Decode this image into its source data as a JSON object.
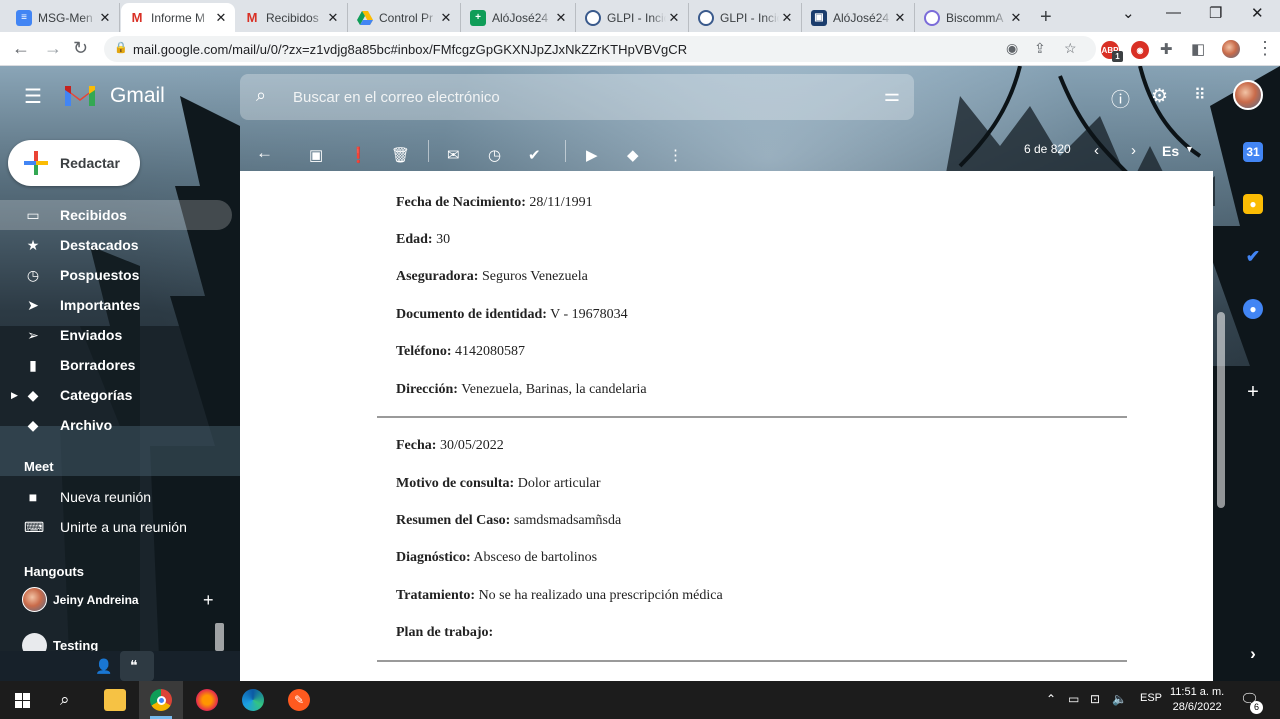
{
  "browser": {
    "tabs": [
      {
        "title": "MSG-Men",
        "icon": "docs-icon",
        "active": false
      },
      {
        "title": "Informe M",
        "icon": "gmail-icon",
        "active": true
      },
      {
        "title": "Recibidos",
        "icon": "gmail-icon",
        "active": false
      },
      {
        "title": "Control Pr",
        "icon": "drive-icon",
        "active": false
      },
      {
        "title": "AlóJosé24",
        "icon": "sheets-icon",
        "active": false
      },
      {
        "title": "GLPI - Incid",
        "icon": "glpi-icon",
        "active": false
      },
      {
        "title": "GLPI - Incid",
        "icon": "glpi-icon",
        "active": false
      },
      {
        "title": "AlóJosé24",
        "icon": "site-icon",
        "active": false
      },
      {
        "title": "BiscommA",
        "icon": "biscomm-icon",
        "active": false
      }
    ],
    "close_symbol": "✕",
    "new_tab_symbol": "+",
    "url": "mail.google.com/mail/u/0/?zx=z1vdjg8a85bc#inbox/FMfcgzGpGKXNJpZJxNkZZrKTHpVBVgCR",
    "extension_badge": "1"
  },
  "gmail": {
    "brand": "Gmail",
    "search_placeholder": "Buscar en el correo electrónico",
    "compose_label": "Redactar",
    "nav": [
      {
        "label": "Recibidos",
        "icon": "inbox-icon",
        "active": true
      },
      {
        "label": "Destacados",
        "icon": "star-icon",
        "active": false
      },
      {
        "label": "Pospuestos",
        "icon": "clock-icon",
        "active": false
      },
      {
        "label": "Importantes",
        "icon": "important-icon",
        "active": false
      },
      {
        "label": "Enviados",
        "icon": "send-icon",
        "active": false
      },
      {
        "label": "Borradores",
        "icon": "draft-icon",
        "active": false
      },
      {
        "label": "Categorías",
        "icon": "label-icon",
        "active": false
      },
      {
        "label": "Archivo",
        "icon": "label-icon",
        "active": false
      }
    ],
    "meet": {
      "title": "Meet",
      "items": [
        {
          "label": "Nueva reunión",
          "icon": "video-icon"
        },
        {
          "label": "Unirte a una reunión",
          "icon": "keyboard-icon"
        }
      ]
    },
    "hangouts": {
      "title": "Hangouts",
      "contacts": [
        "Jeiny Andreina",
        "Testing"
      ]
    },
    "pager": "6 de 820",
    "language": "Es"
  },
  "message": {
    "fields": [
      {
        "label": "Fecha de Nacimiento:",
        "value": "28/11/1991"
      },
      {
        "label": "Edad:",
        "value": "30"
      },
      {
        "label": "Aseguradora:",
        "value": "Seguros Venezuela"
      },
      {
        "label": "Documento de identidad:",
        "value": "V - 19678034"
      },
      {
        "label": "Teléfono:",
        "value": "4142080587"
      },
      {
        "label": "Dirección:",
        "value": "Venezuela, Barinas, la candelaria"
      }
    ],
    "consult_fields": [
      {
        "label": "Fecha:",
        "value": "30/05/2022"
      },
      {
        "label": "Motivo de consulta:",
        "value": "Dolor articular"
      },
      {
        "label": "Resumen del Caso:",
        "value": "samdsmadsamñsda"
      },
      {
        "label": "Diagnóstico:",
        "value": "Absceso de bartolinos"
      },
      {
        "label": "Tratamiento:",
        "value": "No se ha realizado una prescripción médica"
      },
      {
        "label": "Plan de trabajo:",
        "value": ""
      }
    ]
  },
  "taskbar": {
    "language": "ESP",
    "time": "11:51 a. m.",
    "date": "28/6/2022",
    "notifications": "6"
  }
}
